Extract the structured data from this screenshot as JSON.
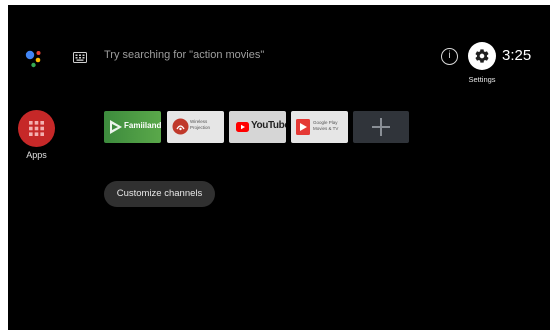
{
  "search": {
    "hint": "Try searching for \"action movies\""
  },
  "header": {
    "info_glyph": "i",
    "settings_label": "Settings",
    "clock": "3:25"
  },
  "apps": {
    "label": "Apps"
  },
  "favorites": [
    {
      "name": "Famiiland",
      "icon": "famiiland-logo",
      "color": "#3d8b3d"
    },
    {
      "name": "Wireless\nProjection",
      "icon": "wireless-projection-logo",
      "color": "#c0392b"
    },
    {
      "name": "YouTube",
      "icon": "youtube-logo",
      "color": "#ff0000"
    },
    {
      "name": "Google Play\nMovies & TV",
      "icon": "play-movies-logo",
      "color": "#e53935"
    },
    {
      "name": "",
      "icon": "add-icon",
      "color": "#30343a"
    }
  ],
  "channels": {
    "customize_label": "Customize channels"
  },
  "colors": {
    "background": "#000000",
    "apps_red": "#c62828",
    "assistant_blue": "#4285f4",
    "assistant_red": "#ea4335",
    "assistant_yellow": "#fbbc05",
    "assistant_green": "#34a853"
  }
}
